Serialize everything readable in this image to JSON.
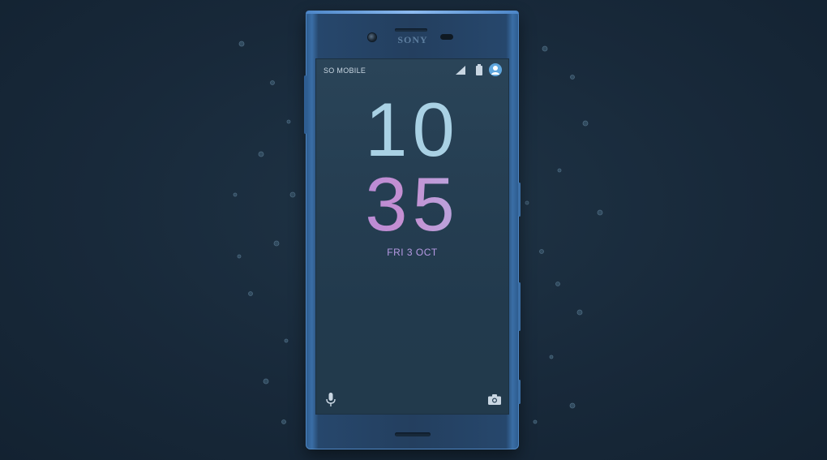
{
  "phone": {
    "brand": "SONY"
  },
  "status_bar": {
    "carrier": "SO MOBILE",
    "icons": [
      "signal-icon",
      "battery-icon",
      "profile-icon"
    ]
  },
  "lock_screen": {
    "hour": "10",
    "minute": "35",
    "date": "FRI 3 OCT",
    "shortcuts": [
      "microphone-icon",
      "camera-icon"
    ]
  },
  "colors": {
    "background": "#18293a",
    "phone_body": "#26476c",
    "screen": "#263f53",
    "hour_text": "#a9d1e4",
    "minute_gradient_start": "#ac86d8",
    "minute_gradient_end": "#b1b7e6",
    "date_text": "#b79ae4",
    "profile_accent": "#5fa6dd"
  }
}
